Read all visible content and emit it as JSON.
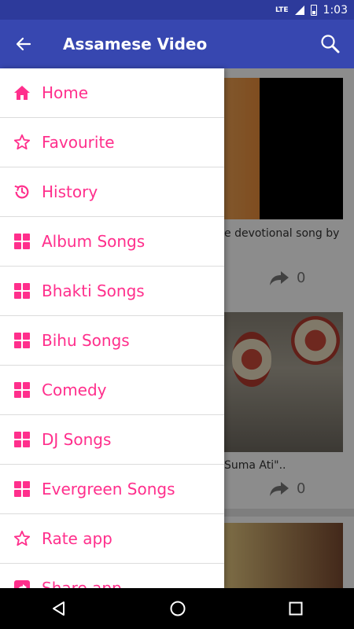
{
  "status_bar": {
    "network": "LTE",
    "time": "1:03"
  },
  "app_bar": {
    "title": "Assamese Video",
    "back_icon": "arrow-back-icon",
    "search_icon": "search-icon"
  },
  "background_feed": {
    "items": [
      {
        "caption": "e devotional song by",
        "share_count": "0"
      },
      {
        "caption": "Suma Ati\"..",
        "share_count": "0"
      }
    ]
  },
  "drawer": {
    "accent": "#ff2f8c",
    "items": [
      {
        "label": "Home",
        "icon": "home-icon"
      },
      {
        "label": "Favourite",
        "icon": "star-outline-icon"
      },
      {
        "label": "History",
        "icon": "history-icon"
      },
      {
        "label": "Album Songs",
        "icon": "grid-icon"
      },
      {
        "label": "Bhakti Songs",
        "icon": "grid-icon"
      },
      {
        "label": "Bihu Songs",
        "icon": "grid-icon"
      },
      {
        "label": "Comedy",
        "icon": "grid-icon"
      },
      {
        "label": "DJ Songs",
        "icon": "grid-icon"
      },
      {
        "label": "Evergreen Songs",
        "icon": "grid-icon"
      },
      {
        "label": "Rate app",
        "icon": "star-outline-icon"
      },
      {
        "label": "Share app",
        "icon": "share-icon"
      }
    ]
  },
  "colors": {
    "app_bar": "#3747b0",
    "status_bar": "#2d3a9b",
    "accent": "#ff2f8c"
  }
}
